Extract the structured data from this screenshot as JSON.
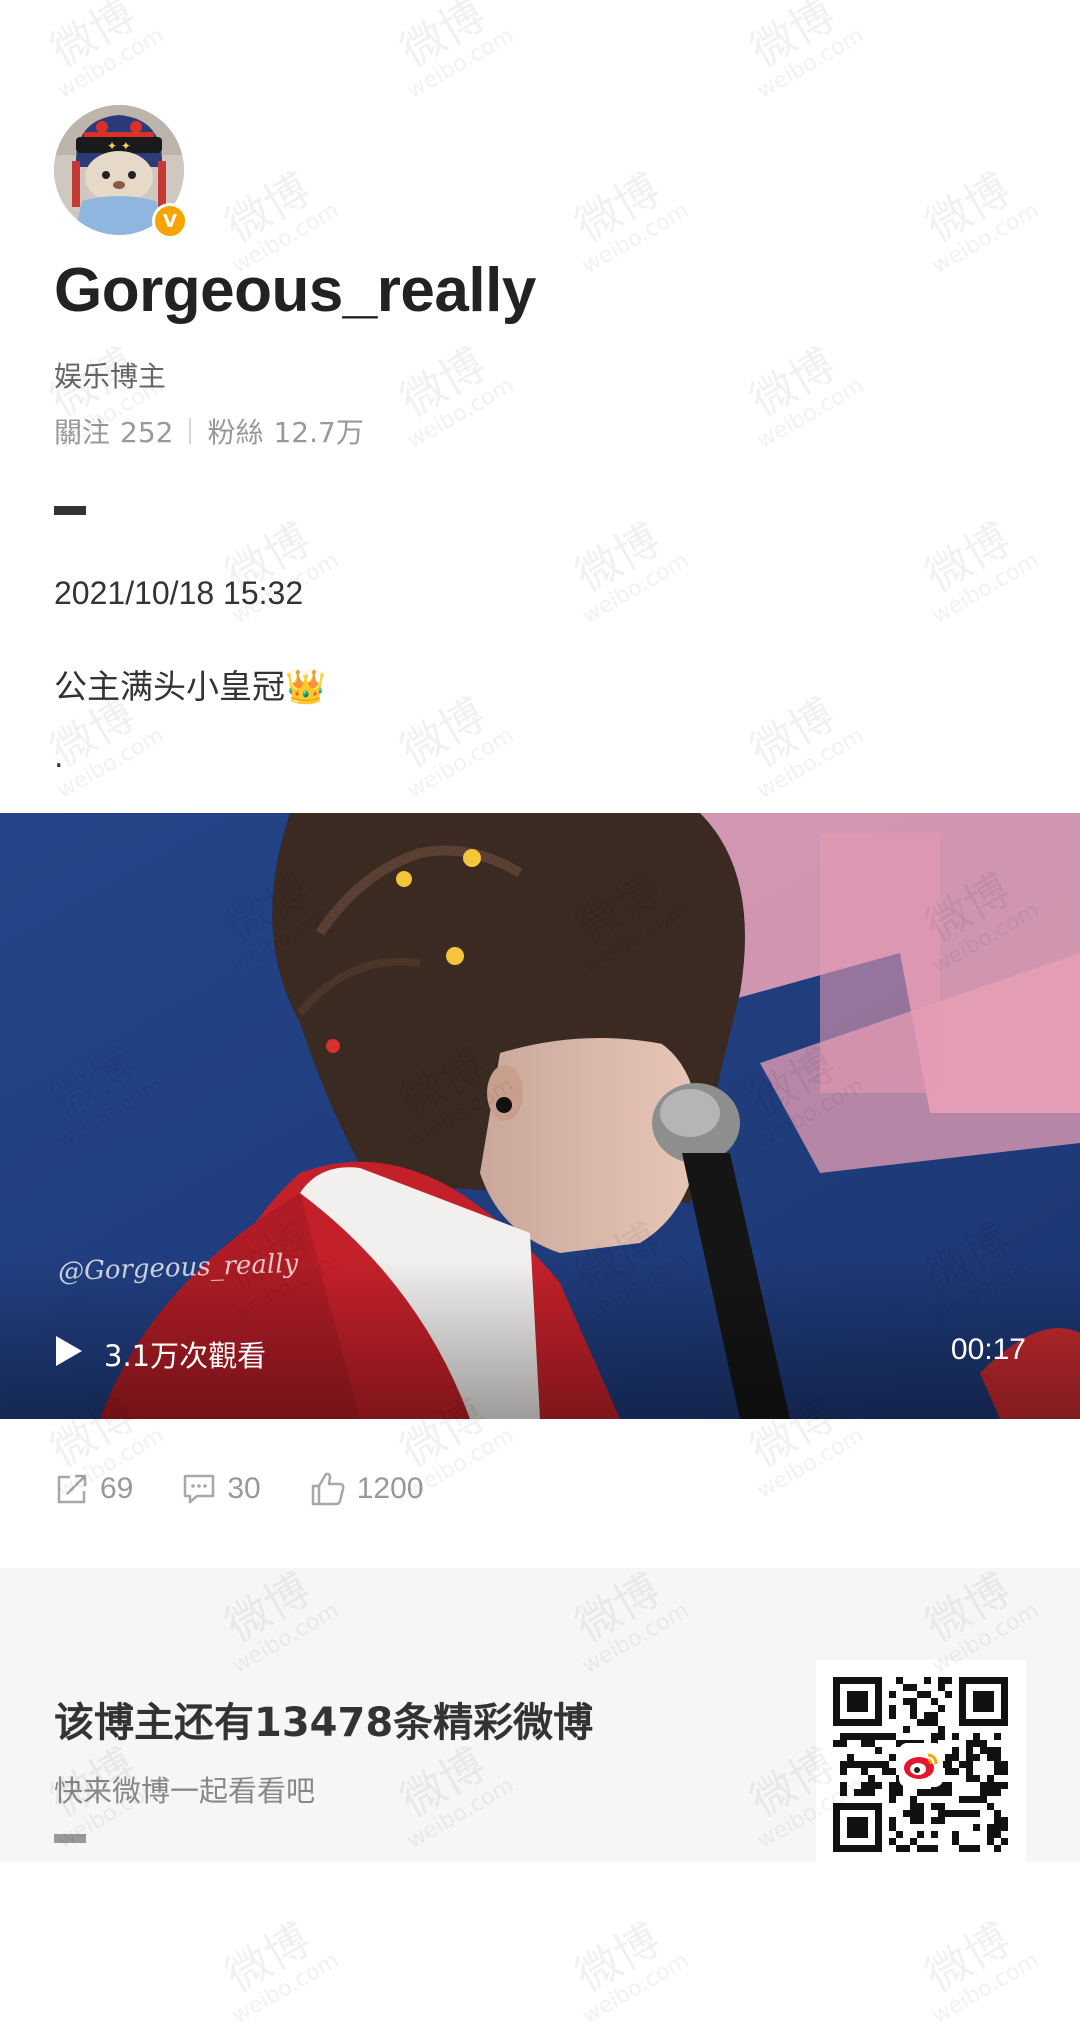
{
  "profile": {
    "username": "Gorgeous_really",
    "category": "娱乐博主",
    "following_label": "關注",
    "following_count": "252",
    "followers_label": "粉絲",
    "followers_count": "12.7万",
    "verified_badge": "V",
    "avatar_icon": "avatar-image"
  },
  "post": {
    "datetime": "2021/10/18 15:32",
    "text": "公主满头小皇冠",
    "emoji": "👑",
    "trailing": "."
  },
  "video": {
    "views": "3.1万次觀看",
    "duration": "00:17",
    "watermark": "@Gorgeous_really",
    "play_icon": "play-icon"
  },
  "actions": {
    "repost_count": "69",
    "comment_count": "30",
    "like_count": "1200"
  },
  "promo": {
    "title": "该博主还有13478条精彩微博",
    "subtitle": "快来微博一起看看吧",
    "qr_icon": "qr-code"
  },
  "watermark": {
    "text": "微博",
    "sub": "weibo.com"
  },
  "colors": {
    "badge": "#f7a300",
    "promo_bg": "#f6f6f6",
    "muted": "#999999",
    "weibo_red": "#e6162d"
  }
}
